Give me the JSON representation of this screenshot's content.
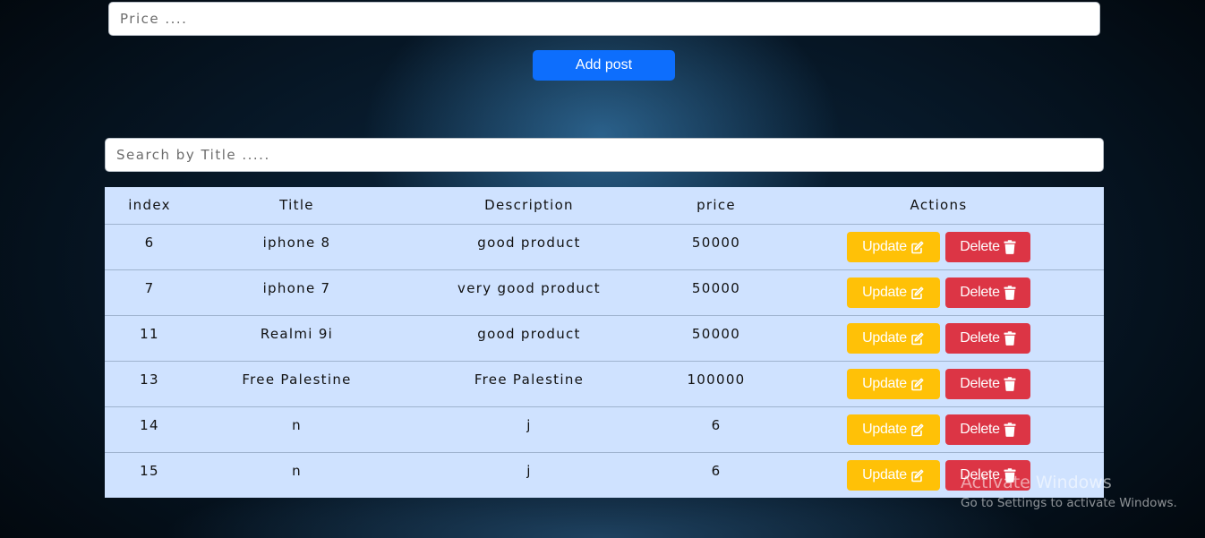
{
  "form": {
    "price_placeholder": "Price ....",
    "add_label": "Add post"
  },
  "search": {
    "placeholder": "Search by Title ....."
  },
  "table": {
    "headers": {
      "index": "index",
      "title": "Title",
      "description": "Description",
      "price": "price",
      "actions": "Actions"
    },
    "update_label": "Update",
    "delete_label": "Delete",
    "rows": [
      {
        "index": "6",
        "title": "iphone 8",
        "description": "good product",
        "price": "50000"
      },
      {
        "index": "7",
        "title": "iphone 7",
        "description": "very good product",
        "price": "50000"
      },
      {
        "index": "11",
        "title": "Realmi 9i",
        "description": "good product",
        "price": "50000"
      },
      {
        "index": "13",
        "title": "Free Palestine",
        "description": "Free Palestine",
        "price": "100000"
      },
      {
        "index": "14",
        "title": "n",
        "description": "j",
        "price": "6"
      },
      {
        "index": "15",
        "title": "n",
        "description": "j",
        "price": "6"
      }
    ]
  },
  "icons": {
    "update": "pencil-square-icon",
    "delete": "trash-icon"
  },
  "colors": {
    "primary": "#0d6efd",
    "warning": "#ffc107",
    "danger": "#dc3545",
    "table_bg": "#cfe2ff"
  },
  "watermark": {
    "title": "Activate Windows",
    "subtitle": "Go to Settings to activate Windows."
  }
}
